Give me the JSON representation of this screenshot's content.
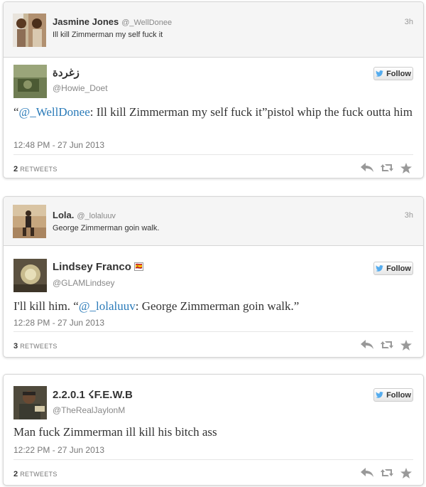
{
  "tweets": [
    {
      "context": {
        "name": "Jasmine Jones",
        "handle": "@_WellDonee",
        "text": "Ill kill Zimmerman my self fuck it",
        "time": "3h"
      },
      "author": {
        "name": "زغردة",
        "handle": "@Howie_Doet"
      },
      "follow_label": "Follow",
      "body": {
        "prefix": "“",
        "mention": "@_WellDonee",
        "rest": ": Ill kill Zimmerman my self fuck it”pistol whip the fuck outta him"
      },
      "timestamp": "12:48 PM - 27 Jun 2013",
      "retweets_count": "2",
      "retweets_label": "RETWEETS"
    },
    {
      "context": {
        "name": "Lola.",
        "handle": "@_lolaluuv",
        "text": "George Zimmerman goin walk.",
        "time": "3h"
      },
      "author": {
        "name": "Lindsey Franco",
        "handle": "@GLAMLindsey",
        "emoji": "🇪🇸"
      },
      "follow_label": "Follow",
      "body": {
        "prefix": "I'll kill him. “",
        "mention": "@_lolaluuv",
        "rest": ": George Zimmerman goin walk.”"
      },
      "timestamp": "12:28 PM - 27 Jun 2013",
      "retweets_count": "3",
      "retweets_label": "RETWEETS"
    },
    {
      "author": {
        "name": "2.2.0.1 ☇F.E.W.B",
        "handle": "@TheRealJaylonM"
      },
      "follow_label": "Follow",
      "body": {
        "prefix": "Man fuck Zimmerman ill kill his bitch ass",
        "mention": "",
        "rest": ""
      },
      "timestamp": "12:22 PM - 27 Jun 2013",
      "retweets_count": "2",
      "retweets_label": "RETWEETS"
    }
  ],
  "colors": {
    "link": "#2b7bb9",
    "bird": "#55acee"
  },
  "icons": [
    "reply-icon",
    "retweet-icon",
    "favorite-icon",
    "twitter-bird-icon"
  ]
}
